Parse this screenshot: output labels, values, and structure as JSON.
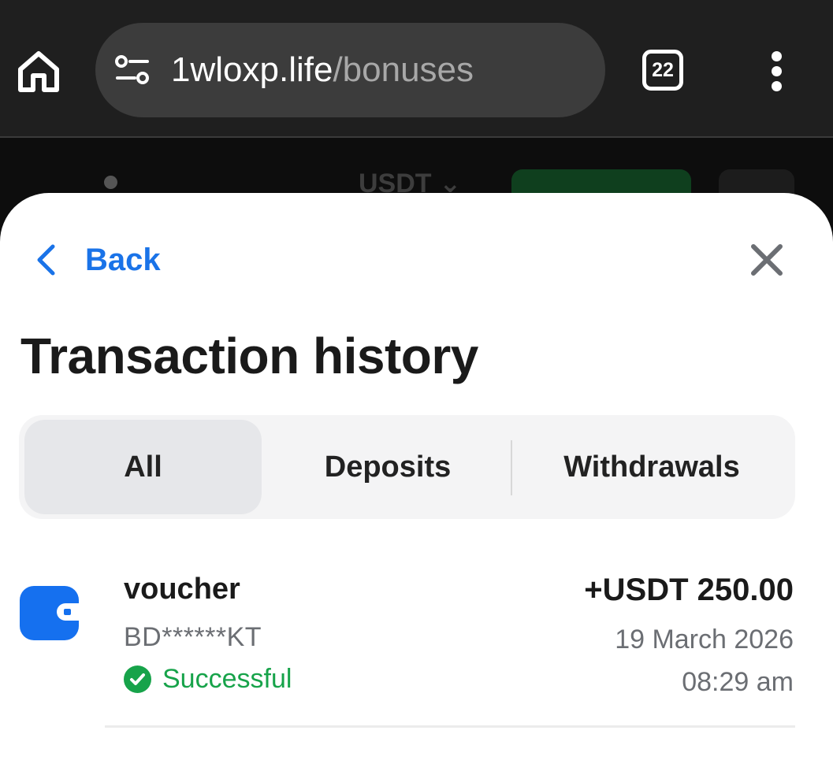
{
  "browser": {
    "url_domain": "1wloxp.life",
    "url_path": "/bonuses",
    "tab_count": "22"
  },
  "background_page": {
    "currency": "USDT"
  },
  "sheet": {
    "back_label": "Back",
    "title": "Transaction history",
    "tabs": [
      {
        "label": "All",
        "selected": true
      },
      {
        "label": "Deposits",
        "selected": false
      },
      {
        "label": "Withdrawals",
        "selected": false
      }
    ]
  },
  "transactions": [
    {
      "name": "voucher",
      "account": "BD******KT",
      "status": "Successful",
      "amount": "+USDT 250.00",
      "date": "19 March 2026",
      "time": "08:29 am",
      "icon": "wallet-icon"
    }
  ],
  "colors": {
    "accent": "#1a73e8",
    "success": "#17a34a",
    "wallet_icon_bg": "#1570ef"
  }
}
